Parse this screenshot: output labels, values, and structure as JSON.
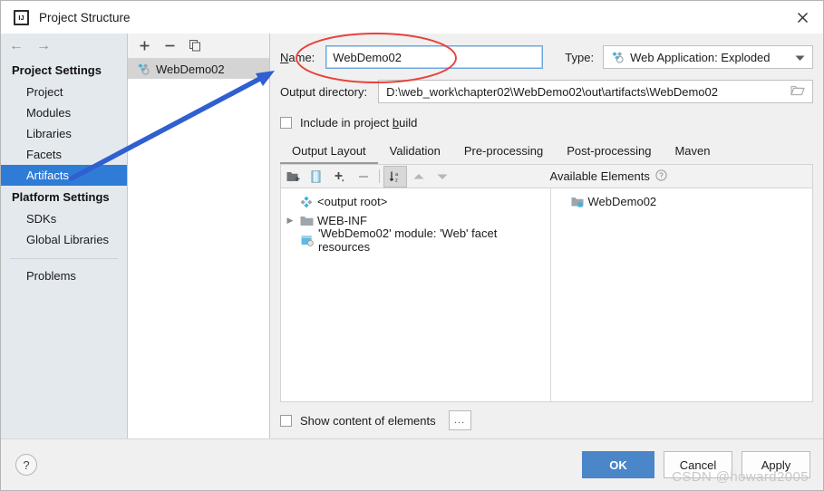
{
  "window": {
    "title": "Project Structure",
    "app_icon": "intellij-idea-icon",
    "close_icon": "close-icon"
  },
  "sidebar": {
    "back_icon": "arrow-left-icon",
    "forward_icon": "arrow-right-icon",
    "groups": [
      {
        "title": "Project Settings",
        "items": [
          {
            "label": "Project",
            "selected": false
          },
          {
            "label": "Modules",
            "selected": false
          },
          {
            "label": "Libraries",
            "selected": false
          },
          {
            "label": "Facets",
            "selected": false
          },
          {
            "label": "Artifacts",
            "selected": true
          }
        ]
      },
      {
        "title": "Platform Settings",
        "items": [
          {
            "label": "SDKs",
            "selected": false
          },
          {
            "label": "Global Libraries",
            "selected": false
          }
        ]
      }
    ],
    "extra": {
      "label": "Problems"
    }
  },
  "artifact_panel": {
    "toolbar": [
      {
        "name": "add-icon",
        "glyph": "+"
      },
      {
        "name": "remove-icon",
        "glyph": "−"
      },
      {
        "name": "copy-icon",
        "glyph": "❐"
      }
    ],
    "items": [
      {
        "label": "WebDemo02",
        "icon": "artifact-icon",
        "selected": true
      }
    ]
  },
  "detail": {
    "name_label": "Name:",
    "name_value": "WebDemo02",
    "type_label": "Type:",
    "type_value": "Web Application: Exploded",
    "type_icon": "artifact-icon",
    "type_caret": "chevron-down-icon",
    "outdir_label": "Output directory:",
    "outdir_value": "D:\\web_work\\chapter02\\WebDemo02\\out\\artifacts\\WebDemo02",
    "browse_icon": "folder-browse-icon",
    "include_label_pre": "Include in project ",
    "include_label_mnemonic": "b",
    "include_label_post": "uild",
    "include_checked": false,
    "tabs": [
      {
        "label": "Output Layout",
        "active": true
      },
      {
        "label": "Validation",
        "active": false
      },
      {
        "label": "Pre-processing",
        "active": false
      },
      {
        "label": "Post-processing",
        "active": false
      },
      {
        "label": "Maven",
        "active": false
      }
    ],
    "content_toolbar": [
      {
        "name": "add-directory-icon",
        "pressed": false
      },
      {
        "name": "add-archive-icon",
        "pressed": false
      },
      {
        "name": "add-copy-icon",
        "pressed": false
      },
      {
        "name": "remove-element-icon",
        "pressed": false
      },
      {
        "name": "sort-alphabetically-icon",
        "pressed": true
      },
      {
        "name": "move-up-icon",
        "pressed": false
      },
      {
        "name": "move-down-icon",
        "pressed": false
      }
    ],
    "available_elements_label": "Available Elements",
    "help_badge_icon": "question-circle-icon",
    "tree": [
      {
        "label": "<output root>",
        "icon": "artifact-icon",
        "indent": 0,
        "twisty": ""
      },
      {
        "label": "WEB-INF",
        "icon": "folder-icon",
        "indent": 0,
        "twisty": "▶"
      },
      {
        "label": "'WebDemo02' module: 'Web' facet resources",
        "icon": "facet-icon",
        "indent": 1,
        "twisty": ""
      }
    ],
    "available": [
      {
        "label": "WebDemo02",
        "icon": "module-icon"
      }
    ],
    "show_content_label": "Show content of elements",
    "show_content_checked": false,
    "ellipsis_label": "..."
  },
  "footer": {
    "help_label": "?",
    "buttons": [
      {
        "label": "OK",
        "primary": true,
        "name": "ok-button"
      },
      {
        "label": "Cancel",
        "primary": false,
        "name": "cancel-button"
      },
      {
        "label": "Apply",
        "primary": false,
        "name": "apply-button"
      }
    ]
  },
  "watermark": {
    "text": "CSDN @howard2005"
  },
  "annotations": {
    "ellipse_color": "#e8423c",
    "arrow_color": "#2f5fd0",
    "ellipse_target": "name-field",
    "arrow_from": "sidebar-item-artifacts",
    "arrow_to": "name-field"
  },
  "colors": {
    "accent": "#2f7cd6",
    "primary_button": "#4a86c8",
    "selection": "#2f7cd6",
    "annotation_red": "#e8423c",
    "annotation_blue": "#2f5fd0"
  }
}
